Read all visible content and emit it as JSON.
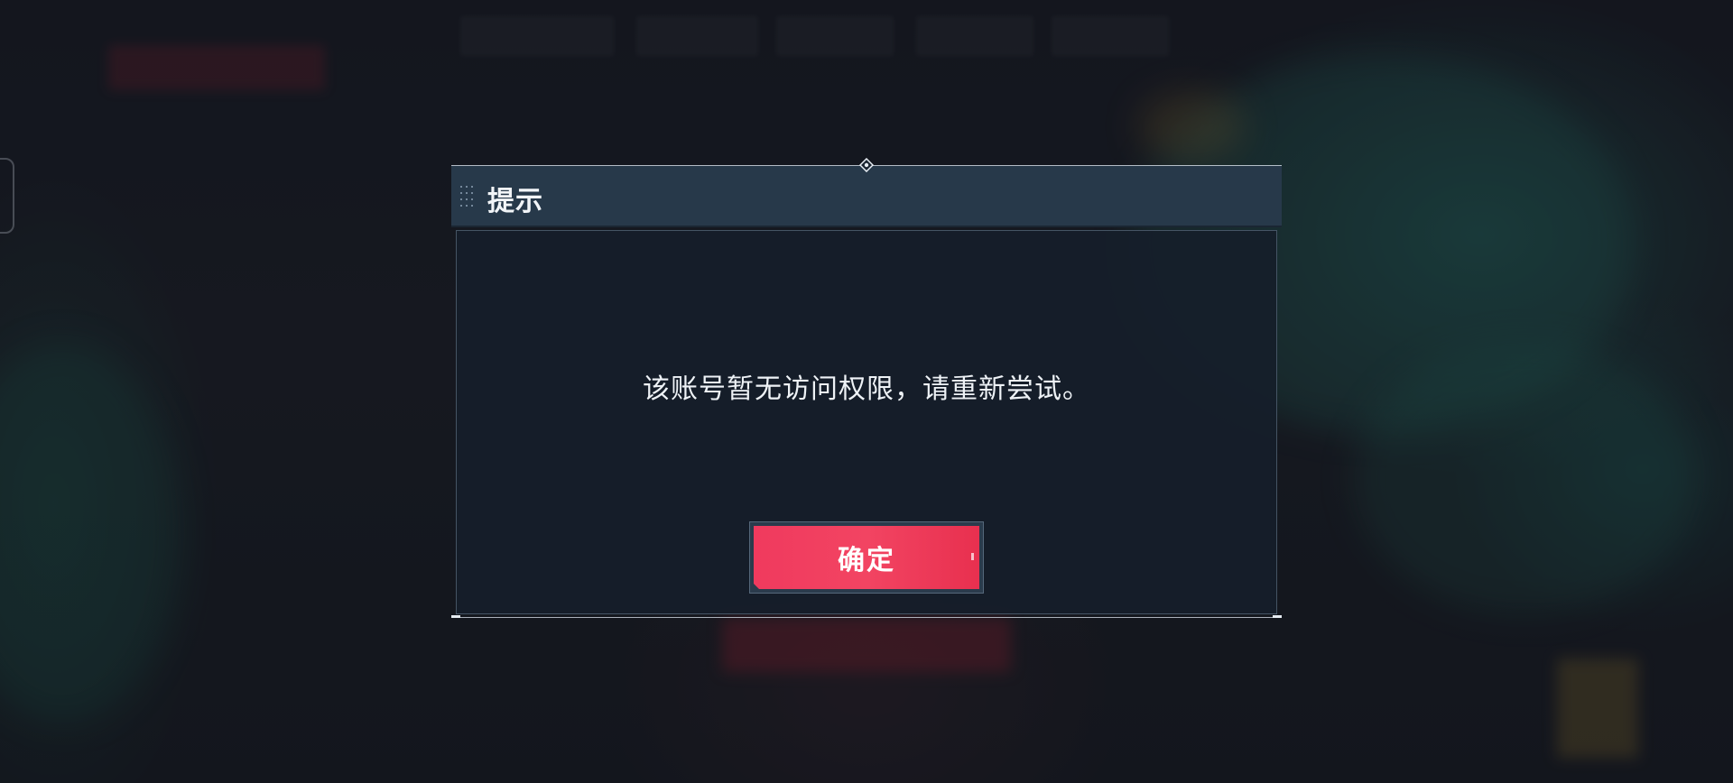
{
  "dialog": {
    "title": "提示",
    "message": "该账号暂无访问权限，请重新尝试。",
    "confirm_label": "确定"
  },
  "icons": {
    "drag_handle": "grip-dots-icon",
    "top_marker": "diamond-pin-icon"
  },
  "colors": {
    "confirm_button": "#f03a5e",
    "header_bg": "#27394a",
    "body_bg": "#161e2a"
  }
}
